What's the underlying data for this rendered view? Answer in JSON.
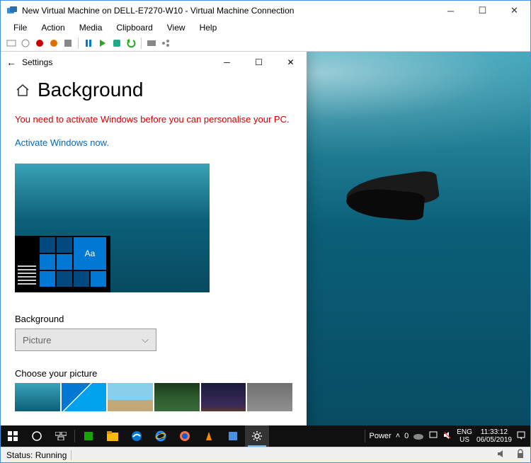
{
  "outer": {
    "title": "New Virtual Machine on DELL-E7270-W10 - Virtual Machine Connection",
    "menu": [
      "File",
      "Action",
      "Media",
      "Clipboard",
      "View",
      "Help"
    ],
    "status_label": "Status:",
    "status_value": "Running"
  },
  "settings": {
    "header_label": "Settings",
    "page_title": "Background",
    "activation_warning": "You need to activate Windows before you can personalise your PC.",
    "activate_link": "Activate Windows now.",
    "preview_sample": "Aa",
    "bg_label": "Background",
    "bg_value": "Picture",
    "choose_label": "Choose your picture"
  },
  "taskbar": {
    "power_label": "Power",
    "power_value": "0",
    "lang_top": "ENG",
    "lang_bottom": "US",
    "time": "11:33:12",
    "date": "06/05/2019"
  },
  "thumbs": [
    {
      "bg": "linear-gradient(180deg,#3aa3b8,#0b5f78)"
    },
    {
      "bg": "linear-gradient(135deg,#0078d4 0%,#0078d4 40%,#fff 40%,#fff 42%,#00a2ed 42%)"
    },
    {
      "bg": "linear-gradient(180deg,#87ceeb 0%,#87ceeb 60%,#c2a878 60%)"
    },
    {
      "bg": "linear-gradient(180deg,#1a3a1a 0%,#2d5a2d 50%,#3a6b3a 100%)"
    },
    {
      "bg": "linear-gradient(180deg,#1a1a3a 0%,#3a2a5a 80%,#5a3a2a 100%)"
    },
    {
      "bg": "linear-gradient(180deg,#707070,#909090)"
    }
  ]
}
